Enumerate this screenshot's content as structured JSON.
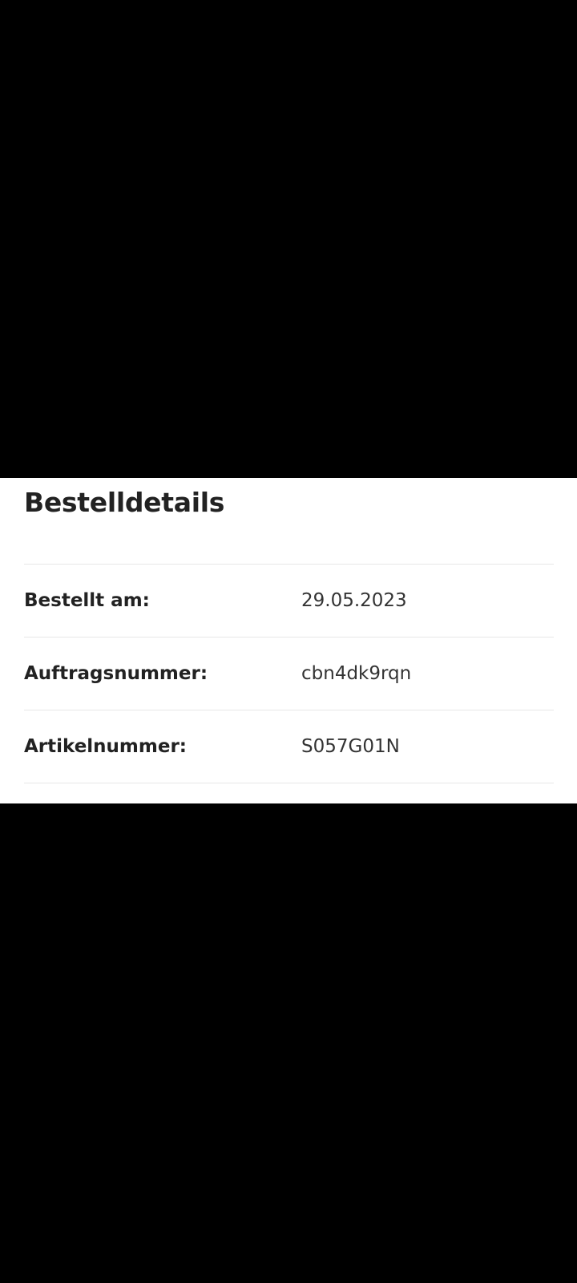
{
  "order_details": {
    "title": "Bestelldetails",
    "rows": [
      {
        "label": "Bestellt am:",
        "value": "29.05.2023"
      },
      {
        "label": "Auftragsnummer:",
        "value": "cbn4dk9rqn"
      },
      {
        "label": "Artikelnummer:",
        "value": "S057G01N"
      }
    ]
  },
  "colors": {
    "background": "#000000",
    "card": "#ffffff",
    "text": "#222222",
    "divider": "#e7e7e7"
  }
}
